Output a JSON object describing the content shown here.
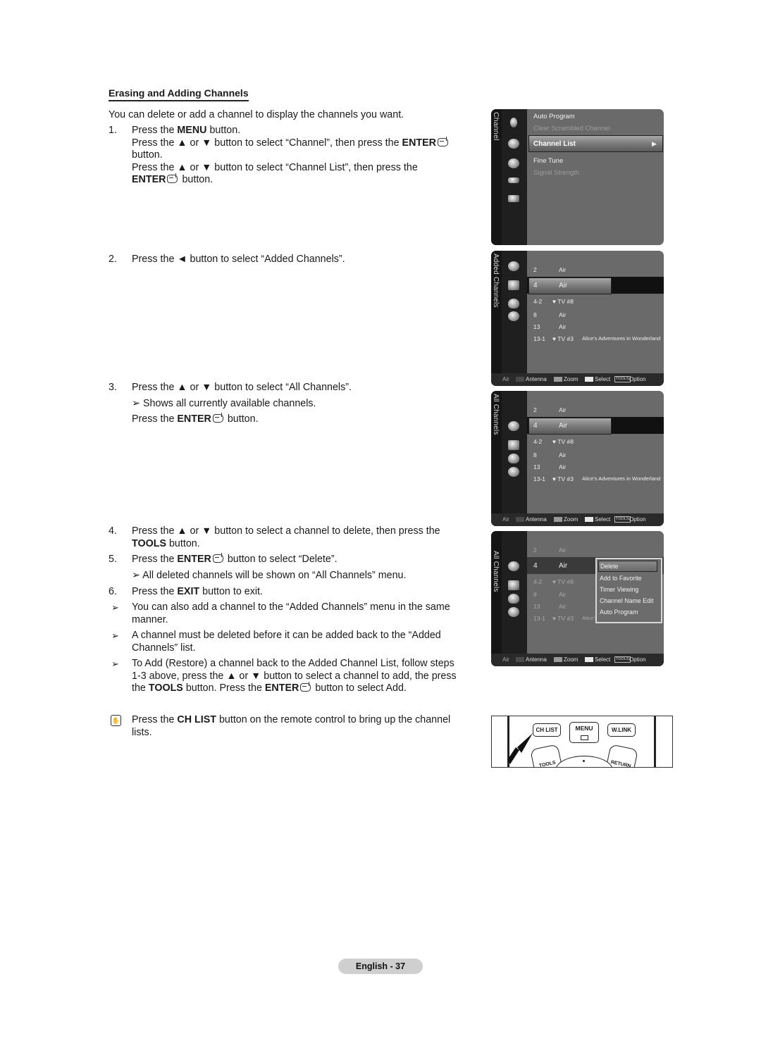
{
  "section": {
    "title": "Erasing and Adding Channels",
    "intro": "You can delete or add a channel to display the channels you want."
  },
  "steps": [
    {
      "number": "1.",
      "lines": [
        {
          "pre": "Press the ",
          "bold": "MENU",
          "post": " button."
        },
        {
          "pre": "Press the ▲ or ▼ button to select “Channel”, then press the ",
          "bold": "ENTER",
          "post": ""
        },
        {
          "pre": "button.",
          "bold": "",
          "post": ""
        },
        {
          "pre": "Press the ▲ or ▼ button to select “Channel List”, then press the",
          "bold": "",
          "post": ""
        },
        {
          "pre": "",
          "bold": "ENTER",
          "post": " button."
        }
      ]
    },
    {
      "number": "2.",
      "text": "Press the ◄ button to select “Added Channels”."
    },
    {
      "number": "3.",
      "text": "Press the ▲ or ▼ button to select “All Channels”.",
      "note": "Shows all currently available channels.",
      "follow": {
        "pre": "Press the ",
        "bold": "ENTER",
        "post": " button."
      }
    },
    {
      "number": "4.",
      "line1": "Press the ▲ or ▼ button to select a channel to delete, then press the",
      "line2_bold": "TOOLS",
      "line2_post": " button."
    },
    {
      "number": "5.",
      "pre": "Press the ",
      "bold": "ENTER",
      "post": " button to select “Delete”.",
      "note": "All deleted channels will be shown on “All Channels” menu."
    },
    {
      "number": "6.",
      "pre": "Press the ",
      "bold": "EXIT",
      "post": " button to exit."
    }
  ],
  "notes": [
    {
      "line1": "You can also add a channel to the “Added Channels” menu in the same",
      "line2": "manner."
    },
    {
      "line1": "A channel must be deleted before it can be added back to the “Added",
      "line2": "Channels” list."
    },
    {
      "line1": "To Add (Restore) a channel back to the Added Channel List, follow steps",
      "line2": "1-3 above, press the ▲ or ▼ button to select a channel to add, the press",
      "line3_pre": "the ",
      "line3_b1": "TOOLS",
      "line3_mid": " button. Press the ",
      "line3_b2": "ENTER",
      "line3_post": " button to select Add."
    }
  ],
  "tip": {
    "pre": "Press the ",
    "bold": "CH LIST",
    "post": " button on the remote control to bring up the channel",
    "line2": "lists."
  },
  "note_marker": "➢",
  "screens": {
    "channel_menu": {
      "side_label": "Channel",
      "items": [
        {
          "label": "Auto Program",
          "state": "normal"
        },
        {
          "label": "Clear Scrambled Channel",
          "state": "disabled"
        },
        {
          "label": "Channel List",
          "state": "selected",
          "arrow": "▶"
        },
        {
          "label": "Fine Tune",
          "state": "normal"
        },
        {
          "label": "Signal Strength",
          "state": "disabled"
        }
      ]
    },
    "added_channels": {
      "side_label": "Added Channels",
      "rows": [
        {
          "num": "2",
          "type": "Air",
          "prog": ""
        },
        {
          "num": "4",
          "type": "Air",
          "prog": "",
          "selected": true
        },
        {
          "num": "4-2",
          "type": "♥ TV #8",
          "prog": ""
        },
        {
          "num": "8",
          "type": "Air",
          "prog": ""
        },
        {
          "num": "13",
          "type": "Air",
          "prog": ""
        },
        {
          "num": "13-1",
          "type": "♥ TV #3",
          "prog": "Alice's Adventures in Wonderland"
        }
      ]
    },
    "all_channels": {
      "side_label": "All Channels",
      "rows": [
        {
          "num": "2",
          "type": "Air",
          "prog": ""
        },
        {
          "num": "4",
          "type": "Air",
          "prog": "",
          "selected": true
        },
        {
          "num": "4-2",
          "type": "♥ TV #8",
          "prog": ""
        },
        {
          "num": "8",
          "type": "Air",
          "prog": ""
        },
        {
          "num": "13",
          "type": "Air",
          "prog": ""
        },
        {
          "num": "13-1",
          "type": "♥ TV #3",
          "prog": "Alice's Adventures in Wonderland"
        }
      ]
    },
    "tools_menu": {
      "side_label": "All Channels",
      "rows": [
        {
          "num": "2",
          "type": "Air",
          "prog": ""
        },
        {
          "num": "4",
          "type": "Air",
          "prog": "",
          "selected": true
        },
        {
          "num": "4-2",
          "type": "♥ TV #8",
          "prog": ""
        },
        {
          "num": "8",
          "type": "Air",
          "prog": ""
        },
        {
          "num": "13",
          "type": "Air",
          "prog": ""
        },
        {
          "num": "13-1",
          "type": "♥ TV #3",
          "prog": "Alice's Adventures in Wonderland"
        }
      ],
      "popup": [
        "Delete",
        "Add to Favorite",
        "Timer Viewing",
        "Channel Name Edit",
        "Auto Program"
      ],
      "popup_selected": "Delete"
    },
    "footer": {
      "source": "Air",
      "antenna": "Antenna",
      "zoom": "Zoom",
      "select": "Select",
      "tools_badge": "TOOLS",
      "option": "Option",
      "colors": {
        "antenna": "#4a4a4a",
        "zoom": "#9a9a9a",
        "select": "#e8e8e8"
      }
    }
  },
  "remote": {
    "buttons": [
      "CH LIST",
      "MENU",
      "W.LINK"
    ],
    "arc_labels": [
      "TOOLS",
      "RETURN"
    ]
  },
  "page_footer": "English - 37"
}
